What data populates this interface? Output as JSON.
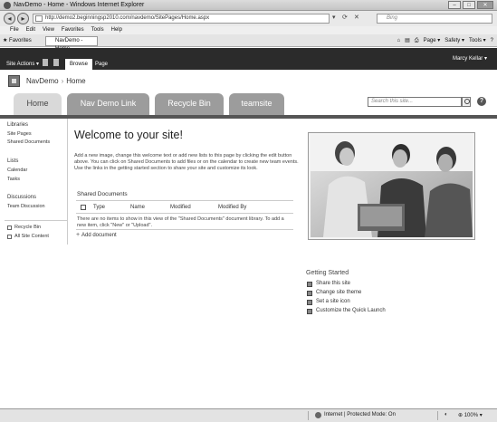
{
  "browser": {
    "window_title": "NavDemo - Home - Windows Internet Explorer",
    "address": "http://demo2.beginningsp2010.com/navdemo/SitePages/Home.aspx",
    "search_placeholder": "Bing",
    "menu": [
      "File",
      "Edit",
      "View",
      "Favorites",
      "Tools",
      "Help"
    ],
    "favorites_label": "Favorites",
    "tab_title": "NavDemo - Home",
    "commands": [
      "Page ▾",
      "Safety ▾",
      "Tools ▾"
    ],
    "status_zone": "Internet | Protected Mode: On",
    "zoom": "100%"
  },
  "ribbon": {
    "site_actions": "Site Actions ▾",
    "tabs": [
      "Browse",
      "Page"
    ],
    "user": "Marcy Kellar ▾"
  },
  "site": {
    "title": "NavDemo",
    "page": "Home",
    "tabs": [
      "Home",
      "Nav Demo Link",
      "Recycle Bin",
      "teamsite"
    ],
    "search_placeholder": "Search this site..."
  },
  "quick_launch": {
    "libraries_heading": "Libraries",
    "libraries": [
      "Site Pages",
      "Shared Documents"
    ],
    "lists_heading": "Lists",
    "lists": [
      "Calendar",
      "Tasks"
    ],
    "discussions_heading": "Discussions",
    "discussions": [
      "Team Discussion"
    ],
    "recycle_bin": "Recycle Bin",
    "all_content": "All Site Content"
  },
  "main": {
    "welcome": "Welcome to your site!",
    "body": "Add a new image, change this welcome text or add new lists to this page by clicking the edit button above. You can click on Shared Documents to add files or on the calendar to create new team events. Use the links in the getting started section to share your site and customize its look.",
    "shared_docs_title": "Shared Documents",
    "columns": [
      "Type",
      "Name",
      "Modified",
      "Modified By"
    ],
    "empty_text": "There are no items to show in this view of the \"Shared Documents\" document library. To add a new item, click \"New\" or \"Upload\".",
    "add_document": "Add document"
  },
  "getting_started": {
    "title": "Getting Started",
    "items": [
      "Share this site",
      "Change site theme",
      "Set a site icon",
      "Customize the Quick Launch"
    ]
  }
}
